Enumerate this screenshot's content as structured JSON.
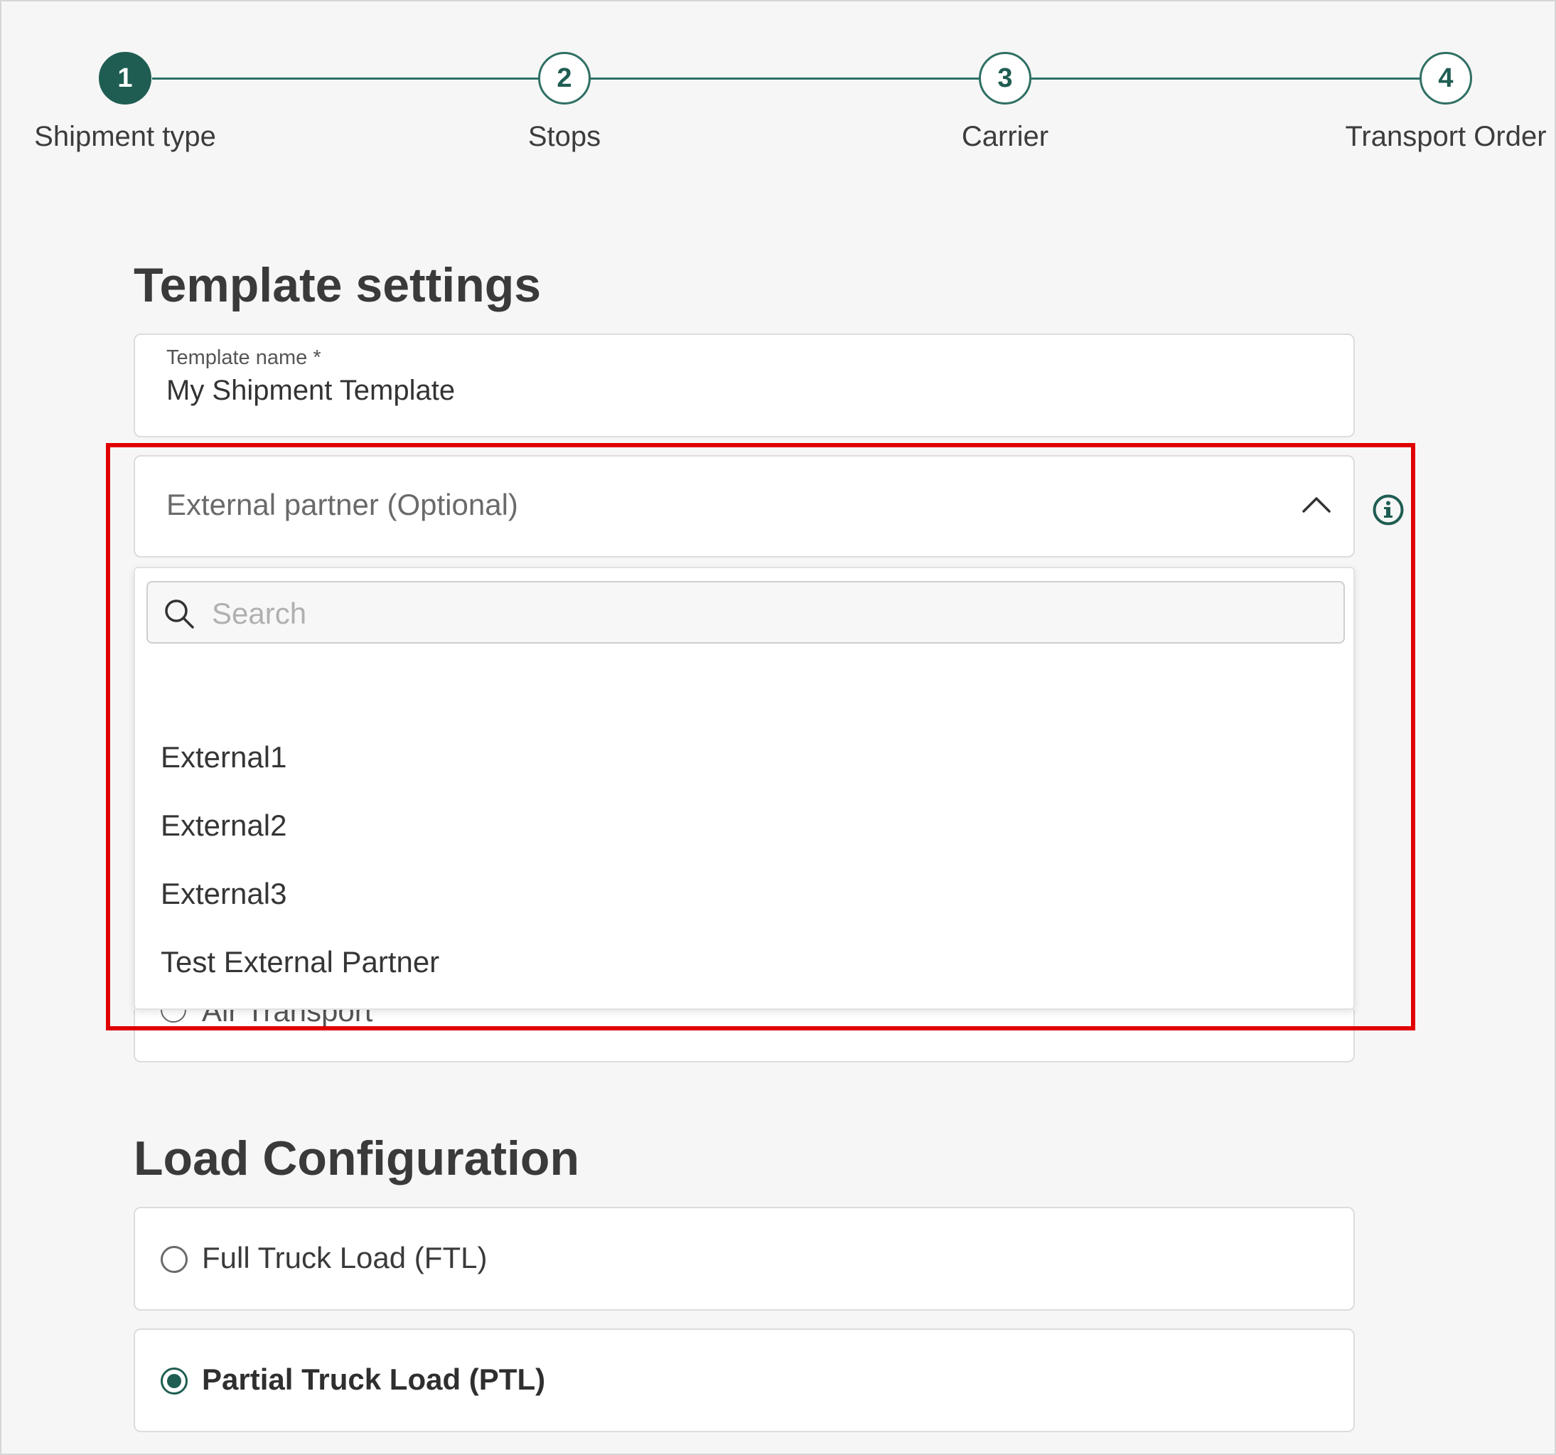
{
  "stepper": {
    "steps": [
      {
        "number": "1",
        "label": "Shipment type",
        "active": true
      },
      {
        "number": "2",
        "label": "Stops",
        "active": false
      },
      {
        "number": "3",
        "label": "Carrier",
        "active": false
      },
      {
        "number": "4",
        "label": "Transport Order",
        "active": false
      }
    ]
  },
  "template_settings": {
    "title": "Template settings",
    "template_name": {
      "label": "Template name *",
      "value": "My Shipment Template"
    },
    "external_partner": {
      "placeholder": "External partner (Optional)",
      "expanded": true,
      "search_placeholder": "Search",
      "options": [
        "External1",
        "External2",
        "External3",
        "Test External Partner"
      ]
    },
    "partially_hidden_option": "Air Transport"
  },
  "load_configuration": {
    "title": "Load Configuration",
    "options": [
      {
        "label": "Full Truck Load (FTL)",
        "selected": false
      },
      {
        "label": "Partial Truck Load (PTL)",
        "selected": true
      }
    ]
  },
  "colors": {
    "accent": "#1f5d52",
    "highlight": "#e00000"
  }
}
